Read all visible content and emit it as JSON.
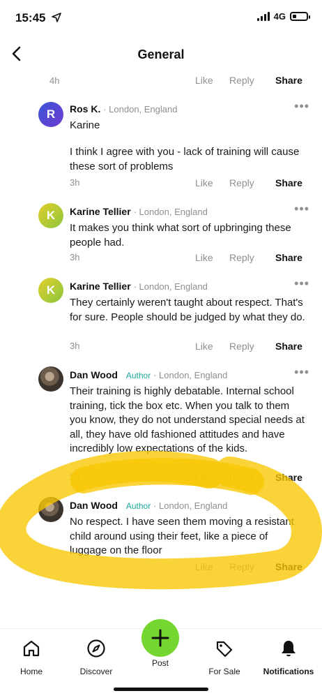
{
  "status_bar": {
    "time": "15:45",
    "network": "4G",
    "battery_level": 0.3
  },
  "header": {
    "title": "General",
    "back_icon": "chevron-left-icon"
  },
  "top_actions": {
    "time": "4h",
    "like": "Like",
    "reply": "Reply",
    "share": "Share"
  },
  "comments": [
    {
      "avatar_letter": "R",
      "name": "Ros K.",
      "location": "· London, England",
      "mention": "Karine",
      "text": "I think I agree with you - lack of training will cause these sort of problems",
      "time": "3h",
      "like": "Like",
      "reply": "Reply",
      "share": "Share",
      "more": "•••"
    },
    {
      "avatar_letter": "K",
      "name": "Karine Tellier",
      "location": "· London, England",
      "text": "It makes you think what sort of upbringing these people had.",
      "time": "3h",
      "like": "Like",
      "reply": "Reply",
      "share": "Share",
      "more": "•••"
    },
    {
      "avatar_letter": "K",
      "name": "Karine Tellier",
      "location": "· London, England",
      "text": "They certainly weren't taught about respect. That's for sure. People should be judged by what they do.",
      "time": "3h",
      "like": "Like",
      "reply": "Reply",
      "share": "Share",
      "more": "•••"
    },
    {
      "name": "Dan Wood",
      "badge": "Author",
      "location": "· London, England",
      "text": "Their training is highly debatable. Internal school training, tick the box etc. When you talk to them you know, they do not understand special needs at all, they have old fashioned attitudes and have incredibly low expectations of the kids.",
      "time": "2h",
      "like": "Like",
      "reply": "Reply",
      "share": "Share",
      "more": "•••"
    },
    {
      "name": "Dan Wood",
      "badge": "Author",
      "location": "· London, England",
      "text": "No respect. I have seen them moving a resistant child around using their feet, like a piece of luggage on the floor",
      "like": "Like",
      "reply": "Reply",
      "share": "Share"
    }
  ],
  "bottom_nav": {
    "home": "Home",
    "discover": "Discover",
    "post": "Post",
    "for_sale": "For Sale",
    "notifications": "Notifications"
  },
  "colors": {
    "author_badge": "#1aa69b",
    "post_button": "#74d62f",
    "highlighter": "#f7c600",
    "muted": "#8f8f8f"
  }
}
